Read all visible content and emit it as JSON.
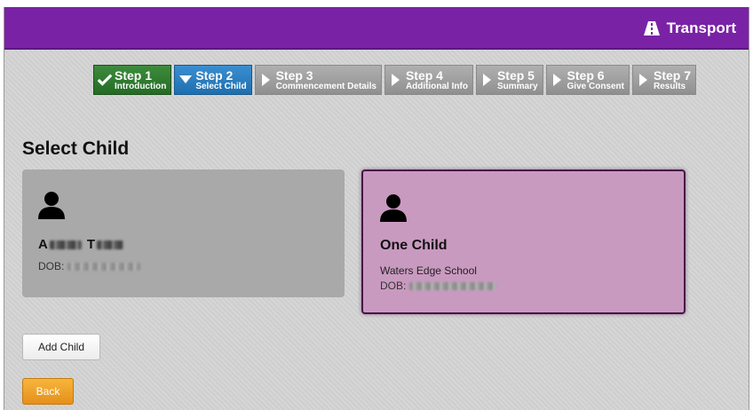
{
  "header": {
    "app_title": "Transport",
    "icon": "road-icon",
    "brand_color": "#7a22a6"
  },
  "steps": [
    {
      "number": "Step 1",
      "name": "Introduction",
      "state": "done"
    },
    {
      "number": "Step 2",
      "name": "Select Child",
      "state": "active"
    },
    {
      "number": "Step 3",
      "name": "Commencement Details",
      "state": "pending"
    },
    {
      "number": "Step 4",
      "name": "Additional Info",
      "state": "pending"
    },
    {
      "number": "Step 5",
      "name": "Summary",
      "state": "pending"
    },
    {
      "number": "Step 6",
      "name": "Give Consent",
      "state": "pending"
    },
    {
      "number": "Step 7",
      "name": "Results",
      "state": "pending"
    }
  ],
  "page": {
    "title": "Select Child"
  },
  "children": [
    {
      "name_visible": "A",
      "name_rest_visible": "T",
      "dob_label": "DOB:",
      "selected": false
    },
    {
      "name": "One Child",
      "school": "Waters Edge School",
      "dob_label": "DOB:",
      "selected": true
    }
  ],
  "buttons": {
    "add_child": "Add Child",
    "back": "Back"
  },
  "colors": {
    "selected_card": "#c99ac0",
    "card": "#a9a9a9",
    "back_button": "#f0a52a",
    "step_done": "#2f7d2f",
    "step_active": "#2a7fc0"
  }
}
